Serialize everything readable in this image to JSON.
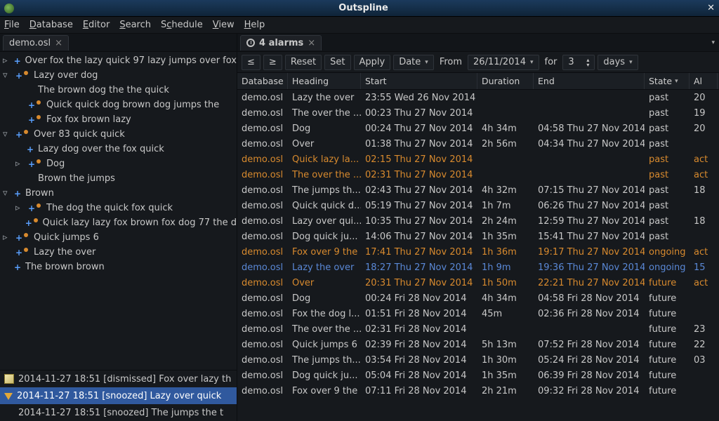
{
  "window": {
    "title": "Outspline",
    "close": "✕"
  },
  "menu": {
    "file": "File",
    "database": "Database",
    "editor": "Editor",
    "search": "Search",
    "schedule": "Schedule",
    "view": "View",
    "help": "Help"
  },
  "leftTab": {
    "label": "demo.osl"
  },
  "tree": [
    {
      "indent": 0,
      "exp": "▹",
      "icon": "plus",
      "text": "Over fox the lazy quick 97 lazy jumps over fox"
    },
    {
      "indent": 0,
      "exp": "▿",
      "icon": "plus-bullet",
      "text": "Lazy over dog"
    },
    {
      "indent": 1,
      "exp": "",
      "icon": "none",
      "text": "The brown dog the the quick"
    },
    {
      "indent": 1,
      "exp": "",
      "icon": "plus-bullet",
      "text": "Quick quick dog brown dog jumps the"
    },
    {
      "indent": 1,
      "exp": "",
      "icon": "plus-bullet",
      "text": "Fox fox brown lazy"
    },
    {
      "indent": 0,
      "exp": "▿",
      "icon": "plus-bullet",
      "text": "Over 83 quick quick"
    },
    {
      "indent": 1,
      "exp": "",
      "icon": "plus",
      "text": "Lazy dog over the fox quick"
    },
    {
      "indent": 1,
      "exp": "▹",
      "icon": "plus-bullet",
      "text": "Dog"
    },
    {
      "indent": 1,
      "exp": "",
      "icon": "none",
      "text": "Brown the jumps"
    },
    {
      "indent": 0,
      "exp": "▿",
      "icon": "plus",
      "text": "Brown"
    },
    {
      "indent": 1,
      "exp": "▹",
      "icon": "plus-bullet",
      "text": "The dog the quick fox quick"
    },
    {
      "indent": 1,
      "exp": "",
      "icon": "plus-bullet",
      "text": "Quick lazy lazy fox brown fox dog 77 the d"
    },
    {
      "indent": 0,
      "exp": "▹",
      "icon": "plus-bullet",
      "text": "Quick jumps 6"
    },
    {
      "indent": 0,
      "exp": "",
      "icon": "plus-bullet",
      "text": "Lazy the over"
    },
    {
      "indent": 0,
      "exp": "",
      "icon": "plus",
      "text": "The brown brown"
    }
  ],
  "alarmLog": [
    {
      "icon": "note",
      "time": "2014-11-27 18:51",
      "status": "[dismissed]",
      "text": "Fox over lazy th",
      "sel": false
    },
    {
      "icon": "bell",
      "time": "2014-11-27 18:51",
      "status": "[snoozed]",
      "text": "Lazy over quick",
      "sel": true
    },
    {
      "icon": "",
      "time": "2014-11-27 18:51",
      "status": "[snoozed]",
      "text": "The jumps the t",
      "sel": false
    }
  ],
  "rightTab": {
    "label": "4 alarms"
  },
  "toolbar": {
    "prev": "≤",
    "next": "≥",
    "reset": "Reset",
    "set": "Set",
    "apply": "Apply",
    "sort": "Date",
    "from": "From",
    "date": "26/11/2014",
    "for": "for",
    "count": "3",
    "unit": "days"
  },
  "headers": {
    "db": "Database",
    "head": "Heading",
    "start": "Start",
    "dur": "Duration",
    "end": "End",
    "state": "State",
    "al": "Al"
  },
  "rows": [
    {
      "db": "demo.osl",
      "head": "Lazy the over",
      "start": "23:55 Wed 26 Nov 2014",
      "dur": "",
      "end": "",
      "state": "past",
      "al": "20",
      "c": ""
    },
    {
      "db": "demo.osl",
      "head": "The over the ...",
      "start": "00:23 Thu 27 Nov 2014",
      "dur": "",
      "end": "",
      "state": "past",
      "al": "19",
      "c": ""
    },
    {
      "db": "demo.osl",
      "head": "Dog",
      "start": "00:24 Thu 27 Nov 2014",
      "dur": "4h 34m",
      "end": "04:58 Thu 27 Nov 2014",
      "state": "past",
      "al": "20",
      "c": ""
    },
    {
      "db": "demo.osl",
      "head": "Over",
      "start": "01:38 Thu 27 Nov 2014",
      "dur": "2h 56m",
      "end": "04:34 Thu 27 Nov 2014",
      "state": "past",
      "al": "",
      "c": ""
    },
    {
      "db": "demo.osl",
      "head": "Quick lazy la...",
      "start": "02:15 Thu 27 Nov 2014",
      "dur": "",
      "end": "",
      "state": "past",
      "al": "act",
      "c": "orange"
    },
    {
      "db": "demo.osl",
      "head": "The over the ...",
      "start": "02:31 Thu 27 Nov 2014",
      "dur": "",
      "end": "",
      "state": "past",
      "al": "act",
      "c": "orange"
    },
    {
      "db": "demo.osl",
      "head": "The jumps th...",
      "start": "02:43 Thu 27 Nov 2014",
      "dur": "4h 32m",
      "end": "07:15 Thu 27 Nov 2014",
      "state": "past",
      "al": "18",
      "c": ""
    },
    {
      "db": "demo.osl",
      "head": "Quick quick d...",
      "start": "05:19 Thu 27 Nov 2014",
      "dur": "1h 7m",
      "end": "06:26 Thu 27 Nov 2014",
      "state": "past",
      "al": "",
      "c": ""
    },
    {
      "db": "demo.osl",
      "head": "Lazy over qui...",
      "start": "10:35 Thu 27 Nov 2014",
      "dur": "2h 24m",
      "end": "12:59 Thu 27 Nov 2014",
      "state": "past",
      "al": "18",
      "c": ""
    },
    {
      "db": "demo.osl",
      "head": "Dog quick ju...",
      "start": "14:06 Thu 27 Nov 2014",
      "dur": "1h 35m",
      "end": "15:41 Thu 27 Nov 2014",
      "state": "past",
      "al": "",
      "c": ""
    },
    {
      "db": "demo.osl",
      "head": "Fox over 9 the",
      "start": "17:41 Thu 27 Nov 2014",
      "dur": "1h 36m",
      "end": "19:17 Thu 27 Nov 2014",
      "state": "ongoing",
      "al": "act",
      "c": "orange"
    },
    {
      "db": "demo.osl",
      "head": "Lazy the over",
      "start": "18:27 Thu 27 Nov 2014",
      "dur": "1h 9m",
      "end": "19:36 Thu 27 Nov 2014",
      "state": "ongoing",
      "al": "15",
      "c": "blue"
    },
    {
      "db": "demo.osl",
      "head": "Over",
      "start": "20:31 Thu 27 Nov 2014",
      "dur": "1h 50m",
      "end": "22:21 Thu 27 Nov 2014",
      "state": "future",
      "al": "act",
      "c": "orange"
    },
    {
      "db": "demo.osl",
      "head": "Dog",
      "start": "00:24 Fri 28 Nov 2014",
      "dur": "4h 34m",
      "end": "04:58 Fri 28 Nov 2014",
      "state": "future",
      "al": "",
      "c": ""
    },
    {
      "db": "demo.osl",
      "head": "Fox the dog l...",
      "start": "01:51 Fri 28 Nov 2014",
      "dur": "45m",
      "end": "02:36 Fri 28 Nov 2014",
      "state": "future",
      "al": "",
      "c": ""
    },
    {
      "db": "demo.osl",
      "head": "The over the ...",
      "start": "02:31 Fri 28 Nov 2014",
      "dur": "",
      "end": "",
      "state": "future",
      "al": "23",
      "c": ""
    },
    {
      "db": "demo.osl",
      "head": "Quick jumps 6",
      "start": "02:39 Fri 28 Nov 2014",
      "dur": "5h 13m",
      "end": "07:52 Fri 28 Nov 2014",
      "state": "future",
      "al": "22",
      "c": ""
    },
    {
      "db": "demo.osl",
      "head": "The jumps th...",
      "start": "03:54 Fri 28 Nov 2014",
      "dur": "1h 30m",
      "end": "05:24 Fri 28 Nov 2014",
      "state": "future",
      "al": "03",
      "c": ""
    },
    {
      "db": "demo.osl",
      "head": "Dog quick ju...",
      "start": "05:04 Fri 28 Nov 2014",
      "dur": "1h 35m",
      "end": "06:39 Fri 28 Nov 2014",
      "state": "future",
      "al": "",
      "c": ""
    },
    {
      "db": "demo.osl",
      "head": "Fox over 9 the",
      "start": "07:11 Fri 28 Nov 2014",
      "dur": "2h 21m",
      "end": "09:32 Fri 28 Nov 2014",
      "state": "future",
      "al": "",
      "c": ""
    }
  ]
}
